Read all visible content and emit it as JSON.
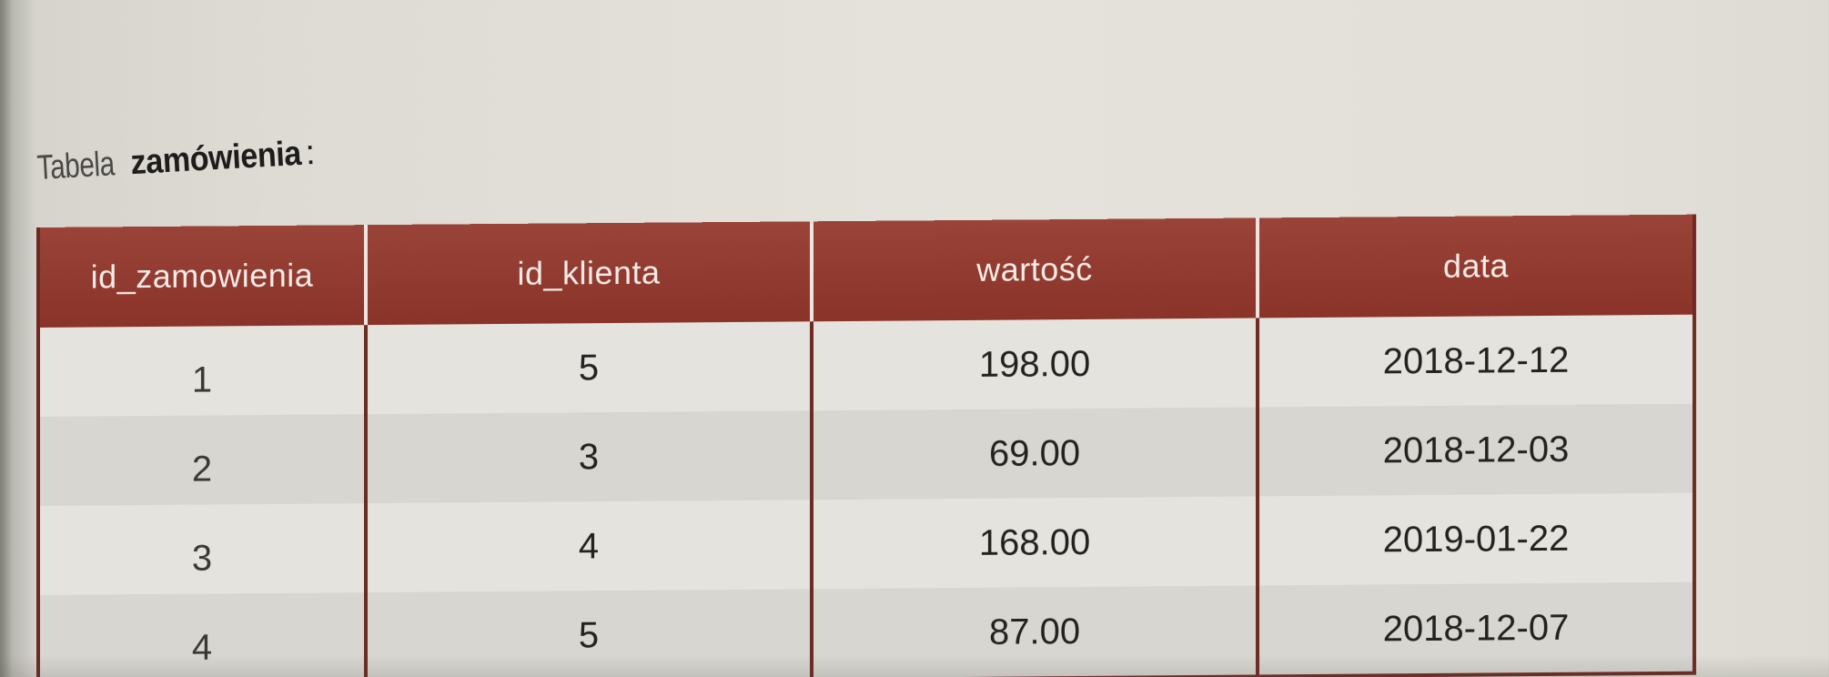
{
  "caption": {
    "prefix": "Tabela",
    "table_name": "zamówienia",
    "colon": ":"
  },
  "table": {
    "headers": [
      "id_zamowienia",
      "id_klienta",
      "wartość",
      "data"
    ],
    "rows": [
      [
        "1",
        "5",
        "198.00",
        "2018-12-12"
      ],
      [
        "2",
        "3",
        "69.00",
        "2018-12-03"
      ],
      [
        "3",
        "4",
        "168.00",
        "2019-01-22"
      ],
      [
        "4",
        "5",
        "87.00",
        "2018-12-07"
      ]
    ]
  },
  "colors": {
    "header_background": "#8f3a30",
    "header_text": "#f5ebe6",
    "table_border": "#6e2a22",
    "page_background": "#e2e0d8"
  }
}
